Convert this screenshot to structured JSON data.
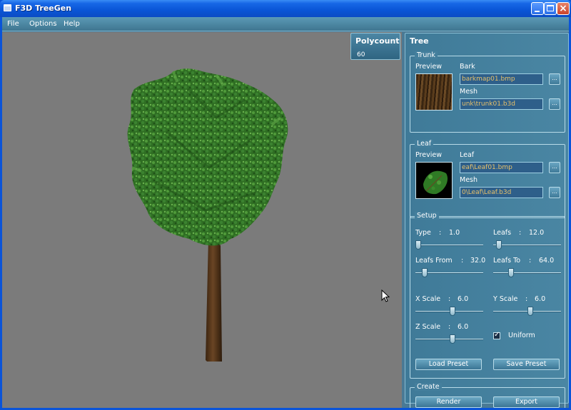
{
  "window": {
    "title": "F3D TreeGen"
  },
  "menu": {
    "items": [
      "File",
      "Options",
      "Help"
    ]
  },
  "polycount": {
    "title": "Polycount",
    "value": "60"
  },
  "panel": {
    "title": "Tree",
    "trunk": {
      "label": "Trunk",
      "preview_label": "Preview",
      "bark_label": "Bark",
      "bark_value": "barkmap01.bmp",
      "mesh_label": "Mesh",
      "mesh_value": "unk\\trunk01.b3d",
      "browse": "..."
    },
    "leaf": {
      "label": "Leaf",
      "preview_label": "Preview",
      "leaf_label": "Leaf",
      "leaf_value": "eaf\\Leaf01.bmp",
      "mesh_label": "Mesh",
      "mesh_value": "0\\Leaf\\Leaf.b3d",
      "browse": "..."
    },
    "setup": {
      "label": "Setup",
      "type": {
        "name": "Type",
        "sep": ":",
        "value": "1.0",
        "level": 0.0
      },
      "leafs": {
        "name": "Leafs",
        "sep": ":",
        "value": "12.0",
        "level": 0.05
      },
      "leafs_from": {
        "name": "Leafs From",
        "sep": ":",
        "value": "32.0",
        "level": 0.1
      },
      "leafs_to": {
        "name": "Leafs To",
        "sep": ":",
        "value": "64.0",
        "level": 0.24
      },
      "x_scale": {
        "name": "X Scale",
        "sep": ":",
        "value": "6.0",
        "level": 0.55
      },
      "y_scale": {
        "name": "Y Scale",
        "sep": ":",
        "value": "6.0",
        "level": 0.55
      },
      "z_scale": {
        "name": "Z Scale",
        "sep": ":",
        "value": "6.0",
        "level": 0.55
      },
      "uniform_label": "Uniform",
      "uniform_checked": true,
      "load_preset": "Load Preset",
      "save_preset": "Save Preset"
    },
    "create": {
      "label": "Create",
      "render": "Render",
      "export": "Export"
    }
  }
}
